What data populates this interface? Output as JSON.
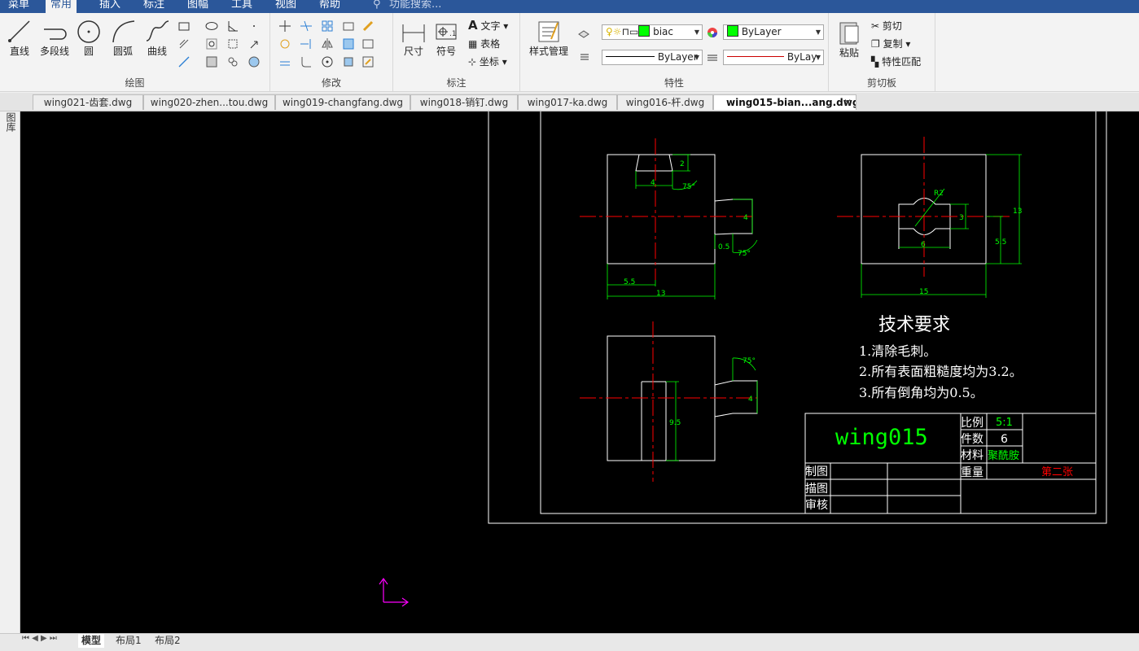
{
  "menu": [
    "菜单",
    "常用",
    "插入",
    "标注",
    "图幅",
    "工具",
    "视图",
    "帮助"
  ],
  "menu_active": "常用",
  "search_placeholder": "功能搜索...",
  "ribbon": {
    "draw": {
      "title": "绘图",
      "buttons": [
        "直线",
        "多段线",
        "圆",
        "圆弧",
        "曲线"
      ]
    },
    "modify": {
      "title": "修改"
    },
    "annotate": {
      "title": "标注",
      "buttons": [
        "尺寸",
        "符号"
      ],
      "text": "文字",
      "table": "表格",
      "coord": "坐标"
    },
    "style": {
      "label": "样式管理"
    },
    "props": {
      "title": "特性",
      "layer": "biac",
      "color": "ByLayer",
      "linetype": "ByLayer",
      "lineweight": "ByLay"
    },
    "clipboard": {
      "title": "剪切板",
      "paste": "粘贴",
      "cut": "剪切",
      "copy": "复制",
      "match": "特性匹配"
    }
  },
  "tabs": [
    "wing021-齿套.dwg",
    "wing020-zhen...tou.dwg",
    "wing019-changfang.dwg",
    "wing018-销钉.dwg",
    "wing017-ka.dwg",
    "wing016-杆.dwg",
    "wing015-bian...ang.dwg"
  ],
  "active_tab": "wing015-bian...ang.dwg",
  "side_label": "图库",
  "layout_tabs": [
    "模型",
    "布局1",
    "布局2"
  ],
  "drawing": {
    "dims_view1": [
      "2",
      "4",
      "75°",
      "4",
      "0.5",
      "75°",
      "5.5",
      "13"
    ],
    "dims_view2": [
      "R2",
      "3",
      "6",
      "13",
      "5.5",
      "15"
    ],
    "dims_view3": [
      "75°",
      "4",
      "9.5"
    ],
    "tech_title": "技术要求",
    "tech_items": [
      "1.清除毛刺。",
      "2.所有表面粗糙度均为3.2。",
      "3.所有倒角均为0.5。"
    ],
    "title_block": {
      "name": "wing015",
      "scale_label": "比例",
      "scale": "5:1",
      "count_label": "件数",
      "count": "6",
      "material_label": "材料",
      "material": "聚酰胺",
      "weight_label": "重量",
      "sheet": "第二张",
      "draw_label": "制图",
      "trace_label": "描图",
      "check_label": "审核"
    }
  },
  "colors": {
    "accent": "#2b579a",
    "green": "#00ff00",
    "red": "#ff0000",
    "magenta": "#ff00ff"
  }
}
